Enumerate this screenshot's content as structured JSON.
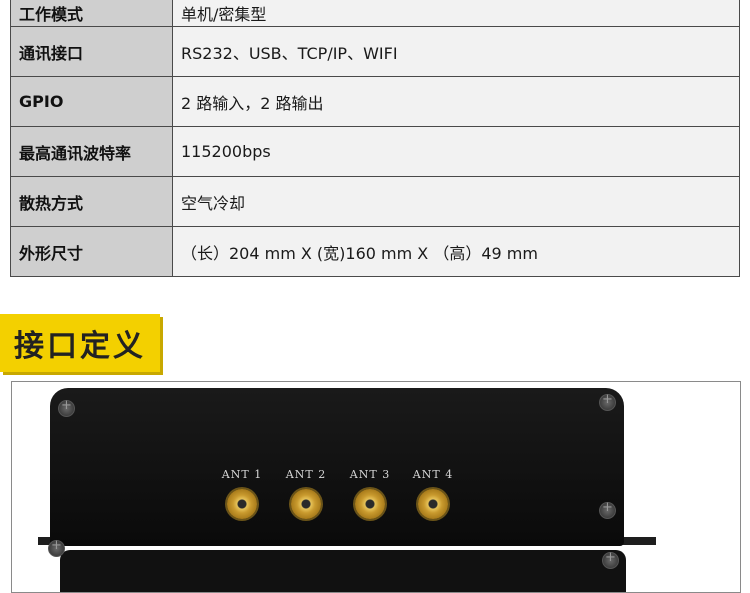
{
  "specs": [
    {
      "label": "工作模式",
      "value": "单机/密集型"
    },
    {
      "label": "通讯接口",
      "value": "RS232、USB、TCP/IP、WIFI"
    },
    {
      "label": "GPIO",
      "value": "2 路输入，2 路输出"
    },
    {
      "label": "最高通讯波特率",
      "value": "115200bps"
    },
    {
      "label": "散热方式",
      "value": "空气冷却"
    },
    {
      "label": "外形尺寸",
      "value": "（长）204 mm X (宽)160 mm X （高）49 mm"
    }
  ],
  "section_title": "接口定义",
  "antennas": [
    "ANT 1",
    "ANT 2",
    "ANT 3",
    "ANT 4"
  ],
  "colors": {
    "badge": "#f3d000",
    "label_cell": "#cfcfcf",
    "value_cell": "#f2f2f2",
    "device": "#111111",
    "connector": "#c99a2e"
  }
}
